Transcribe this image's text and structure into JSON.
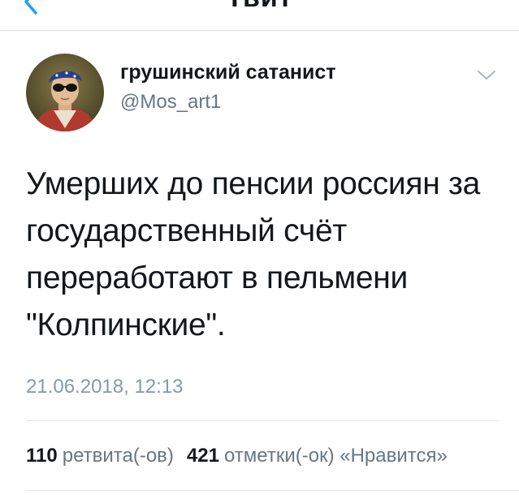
{
  "nav": {
    "title": "Твит",
    "back_icon": "chevron-left-icon"
  },
  "author": {
    "name": "грушинский сатанист",
    "handle": "@Mos_art1",
    "avatar_icon": "avatar-portrait",
    "menu_icon": "chevron-down-icon"
  },
  "tweet": {
    "lines": [
      "Умерших до пенсии россиян за",
      "государственный счёт",
      "переработают в пельмени",
      "\"Колпинские\"."
    ],
    "timestamp": "21.06.2018, 12:13"
  },
  "stats": {
    "retweets_count": "110",
    "retweets_label": "ретвита(-ов)",
    "likes_count": "421",
    "likes_label": "отметки(-ок) «Нравится»"
  },
  "colors": {
    "accent": "#1da1f2",
    "text": "#14171a",
    "secondary": "#657786",
    "timestamp": "#8899a6",
    "divider": "#e1e8ed"
  }
}
